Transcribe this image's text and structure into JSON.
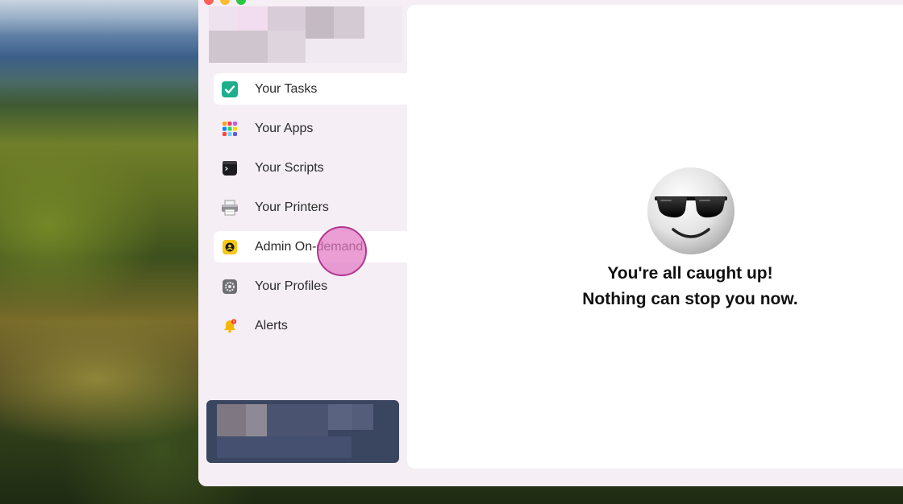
{
  "window": {
    "controls": [
      "close",
      "minimize",
      "zoom"
    ]
  },
  "sidebar": {
    "items": [
      {
        "label": "Your Tasks",
        "icon": "checkmark-icon",
        "state": "active"
      },
      {
        "label": "Your Apps",
        "icon": "apps-grid-icon",
        "state": "normal"
      },
      {
        "label": "Your Scripts",
        "icon": "terminal-icon",
        "state": "normal"
      },
      {
        "label": "Your Printers",
        "icon": "printer-icon",
        "state": "normal"
      },
      {
        "label": "Admin On-demand",
        "icon": "admin-badge-icon",
        "state": "hover"
      },
      {
        "label": "Your Profiles",
        "icon": "gear-icon",
        "state": "normal"
      },
      {
        "label": "Alerts",
        "icon": "bell-icon",
        "state": "normal"
      }
    ]
  },
  "content": {
    "emoji": "smiling-face-with-sunglasses-icon",
    "line1": "You're all caught up!",
    "line2": "Nothing can stop you now."
  },
  "colors": {
    "sidebar_bg": "#f5eef5",
    "tasks_icon": "#1fae8c",
    "admin_icon": "#f6c817",
    "account_block": "#3a4560",
    "click_indicator": "#e278c4"
  }
}
